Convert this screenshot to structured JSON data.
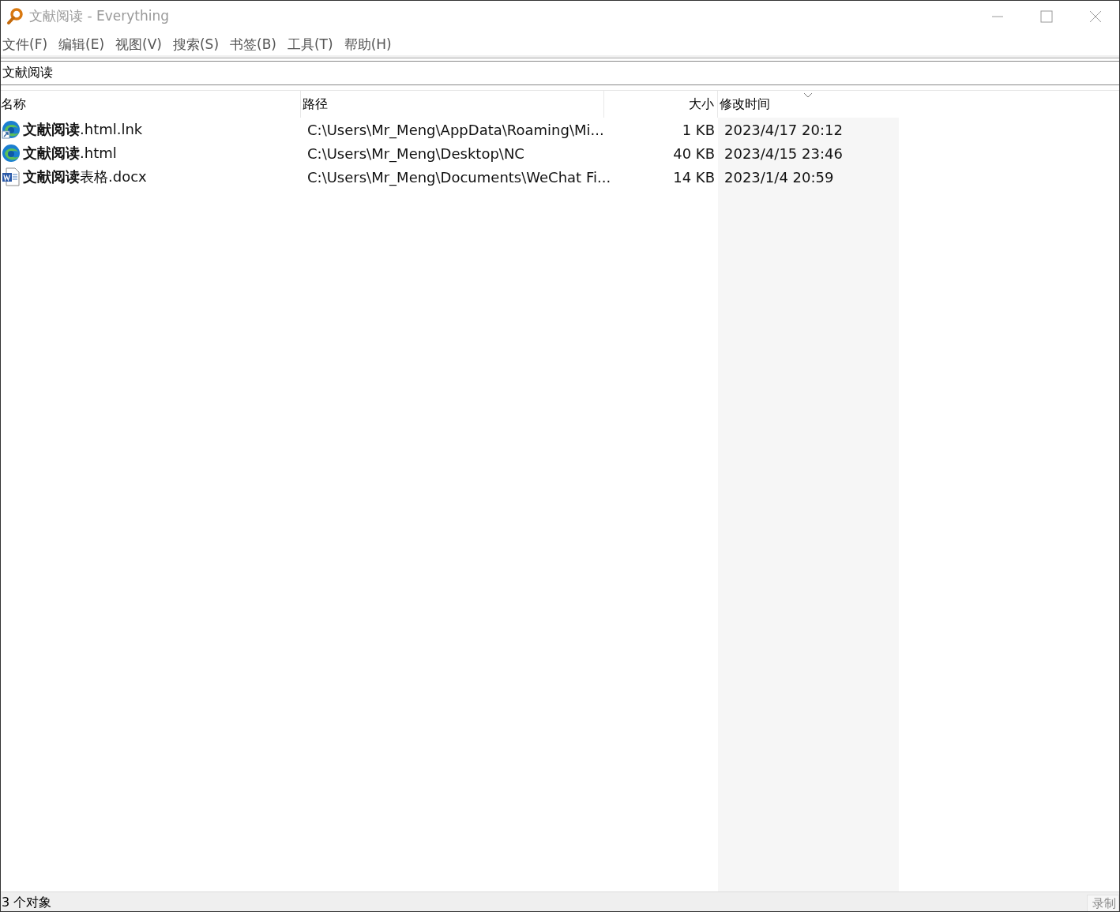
{
  "window": {
    "title": "文献阅读 - Everything"
  },
  "menu": [
    "文件(F)",
    "编辑(E)",
    "视图(V)",
    "搜索(S)",
    "书签(B)",
    "工具(T)",
    "帮助(H)"
  ],
  "search": {
    "value": "文献阅读"
  },
  "columns": [
    {
      "label": "名称",
      "kind": "text",
      "sorted": false
    },
    {
      "label": "路径",
      "kind": "text",
      "sorted": false
    },
    {
      "label": "大小",
      "kind": "number",
      "sorted": false
    },
    {
      "label": "修改时间",
      "kind": "text",
      "sorted": true
    }
  ],
  "rows": [
    {
      "kind": "shortcut",
      "cells": [
        "**文献阅读**.html.lnk",
        "C:\\Users\\Mr_Meng\\AppData\\Roaming\\Mi...",
        "1 KB",
        "2023/4/17 20:12"
      ]
    },
    {
      "kind": "html",
      "cells": [
        "**文献阅读**.html",
        "C:\\Users\\Mr_Meng\\Desktop\\NC",
        "40 KB",
        "2023/4/15 23:46"
      ]
    },
    {
      "kind": "docx",
      "cells": [
        "**文献阅读**表格.docx",
        "C:\\Users\\Mr_Meng\\Documents\\WeChat Fi...",
        "14 KB",
        "2023/1/4 20:59"
      ]
    }
  ],
  "status_bar": {
    "text": "3 个对象",
    "overlay_button": "录制"
  }
}
